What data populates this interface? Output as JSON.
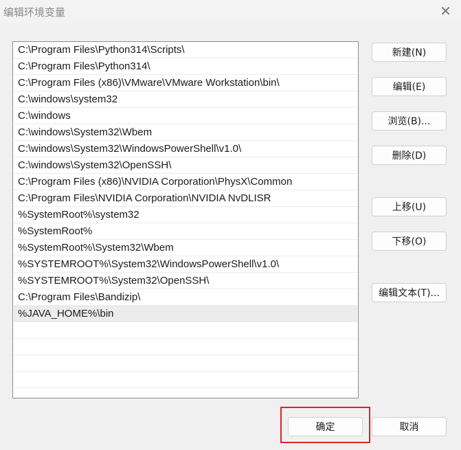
{
  "window": {
    "title": "编辑环境变量",
    "close": "✕"
  },
  "paths": [
    "C:\\Program Files\\Python314\\Scripts\\",
    "C:\\Program Files\\Python314\\",
    "C:\\Program Files (x86)\\VMware\\VMware Workstation\\bin\\",
    "C:\\windows\\system32",
    "C:\\windows",
    "C:\\windows\\System32\\Wbem",
    "C:\\windows\\System32\\WindowsPowerShell\\v1.0\\",
    "C:\\windows\\System32\\OpenSSH\\",
    "C:\\Program Files (x86)\\NVIDIA Corporation\\PhysX\\Common",
    "C:\\Program Files\\NVIDIA Corporation\\NVIDIA NvDLISR",
    "%SystemRoot%\\system32",
    "%SystemRoot%",
    "%SystemRoot%\\System32\\Wbem",
    "%SYSTEMROOT%\\System32\\WindowsPowerShell\\v1.0\\",
    "%SYSTEMROOT%\\System32\\OpenSSH\\",
    "C:\\Program Files\\Bandizip\\",
    "%JAVA_HOME%\\bin",
    "",
    "",
    "",
    "",
    ""
  ],
  "selected_index": 16,
  "buttons": {
    "new": "新建(N)",
    "edit": "编辑(E)",
    "browse": "浏览(B)...",
    "delete": "删除(D)",
    "up": "上移(U)",
    "down": "下移(O)",
    "edit_text": "编辑文本(T)...",
    "ok": "确定",
    "cancel": "取消"
  }
}
